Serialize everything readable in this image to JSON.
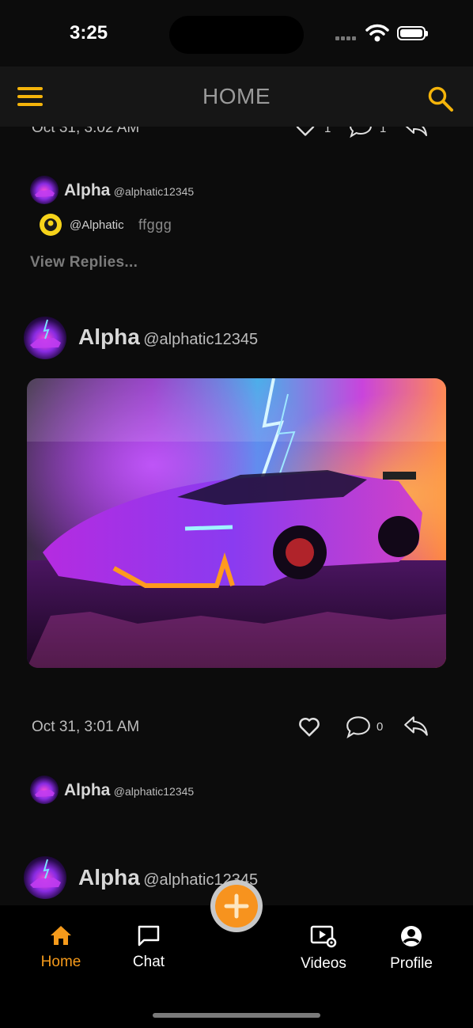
{
  "status_bar": {
    "time": "3:25"
  },
  "header": {
    "title": "HOME"
  },
  "feed": {
    "prev_post": {
      "date": "Oct 31, 3:02 AM",
      "like_count": "1",
      "comment_count": "1"
    },
    "comment": {
      "name": "Alpha",
      "handle": "@alphatic12345",
      "reply_mention": "@Alphatic",
      "reply_text": "ffggg",
      "view_replies": "View Replies..."
    },
    "post": {
      "name": "Alpha",
      "handle": "@alphatic12345",
      "date": "Oct 31, 3:01 AM",
      "comment_count": "0"
    },
    "post_comment": {
      "name": "Alpha",
      "handle": "@alphatic12345"
    },
    "next_post": {
      "name": "Alpha",
      "handle": "@alphatic12345"
    }
  },
  "bottom_nav": {
    "items": [
      {
        "label": "Home",
        "icon": "home-icon",
        "active": true
      },
      {
        "label": "Chat",
        "icon": "chat-icon"
      },
      {
        "label": "Videos",
        "icon": "videos-icon"
      },
      {
        "label": "Profile",
        "icon": "profile-icon"
      }
    ],
    "fab_icon": "plus-icon"
  },
  "colors": {
    "accent": "#f5b40a",
    "active_tab": "#f59a1b",
    "fab": "#f7931e",
    "background": "#0c0c0c"
  }
}
